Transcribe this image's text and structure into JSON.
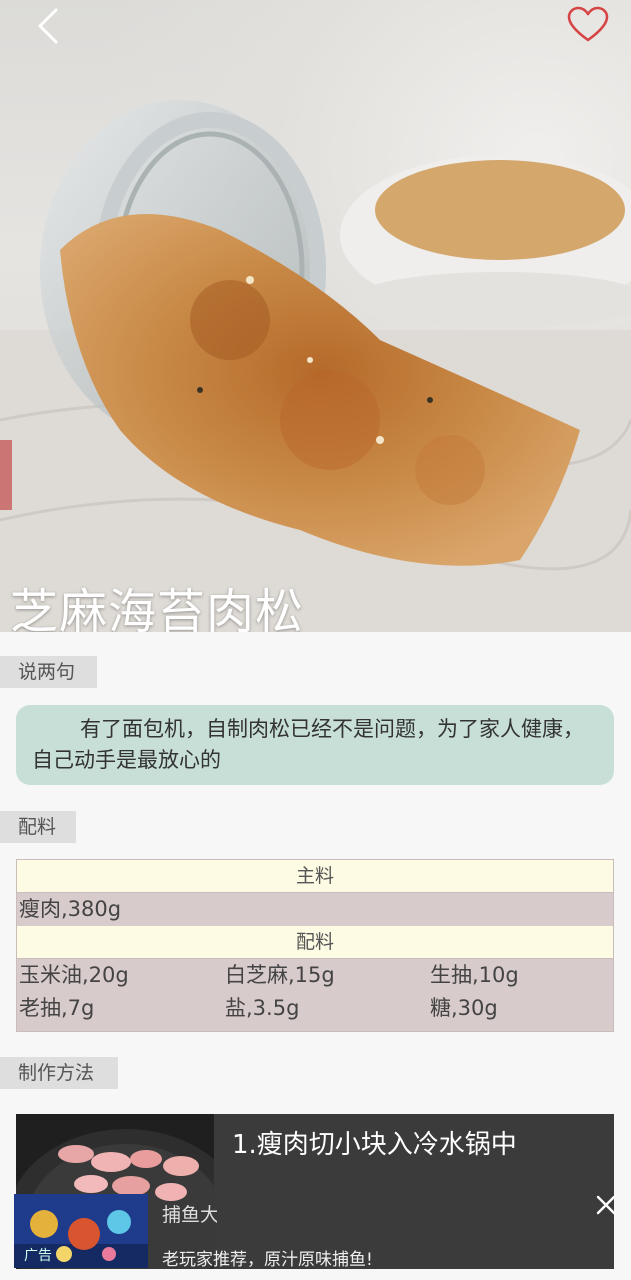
{
  "recipe": {
    "title": "芝麻海苔肉松"
  },
  "header": {
    "back_icon": "chevron-left-icon",
    "favorite_icon": "heart-outline-icon",
    "favorite_color": "#d64545"
  },
  "sections": {
    "say_label": "说两句",
    "ingredients_label": "配料",
    "method_label": "制作方法"
  },
  "description": {
    "text": "有了面包机，自制肉松已经不是问题，为了家人健康，自己动手是最放心的",
    "bg_color": "#c7dfd7"
  },
  "ingredients": {
    "main_header": "主料",
    "main": [
      "瘦肉,380g"
    ],
    "extra_header": "配料",
    "extra": [
      [
        "玉米油,20g",
        "白芝麻,15g",
        "生抽,10g"
      ],
      [
        "老抽,7g",
        "盐,3.5g",
        "糖,30g"
      ]
    ]
  },
  "steps": [
    {
      "text": "1.瘦肉切小块入冷水锅中"
    }
  ],
  "ad": {
    "label": "广告",
    "title": "捕鱼大",
    "description": "老玩家推荐，原汁原味捕鱼!",
    "close_icon": "close-icon"
  }
}
